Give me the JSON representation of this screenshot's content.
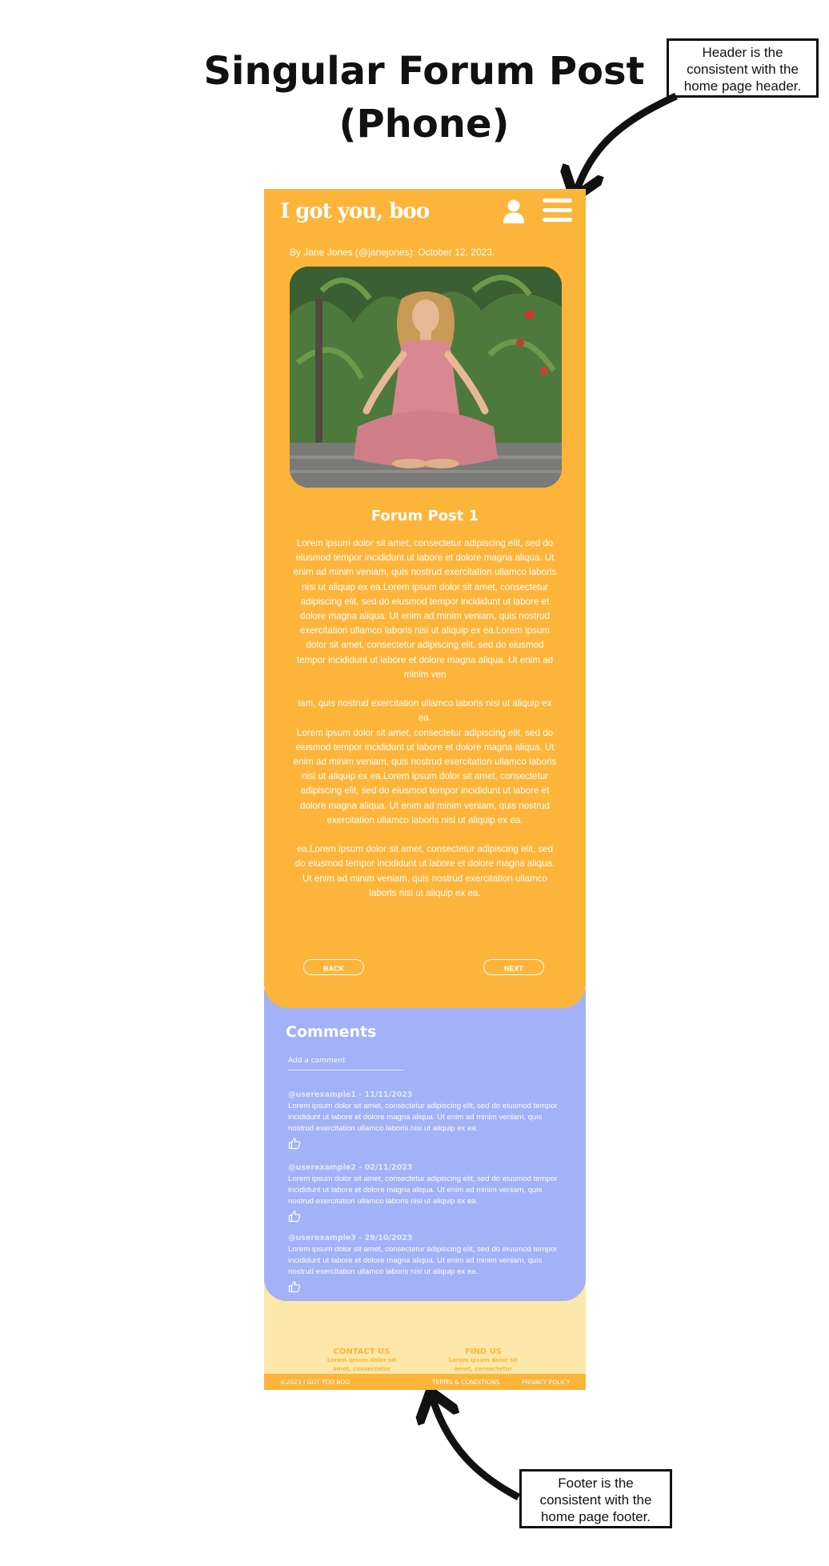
{
  "page": {
    "title_line1": "Singular Forum Post",
    "title_line2": "(Phone)"
  },
  "annotations": {
    "header_note": "Header is the consistent with the home page header.",
    "footer_note": "Footer is the consistent with the home page footer."
  },
  "header": {
    "logo": "I got you, boo",
    "icons": [
      "user-icon",
      "menu-icon"
    ]
  },
  "post": {
    "byline": "By Jane Jones (@janejones): October 12, 2023.",
    "image_alt": "Woman meditating cross-legged in a garden",
    "title": "Forum Post 1",
    "paragraphs": [
      "Lorem ipsum dolor sit amet, consectetur adipiscing elit, sed do eiusmod tempor incididunt ut labore et dolore magna aliqua. Ut enim ad minim veniam, quis nostrud exercitation ullamco laboris nisi ut aliquip ex ea.Lorem ipsum dolor sit amet, consectetur adipiscing elit, sed do eiusmod tempor incididunt ut labore et dolore magna aliqua. Ut enim ad minim veniam, quis nostrud exercitation ullamco laboris nisi ut aliquip ex ea.Lorem ipsum dolor sit amet, consectetur adipiscing elit, sed do eiusmod tempor incididunt ut labore et dolore magna aliqua. Ut enim ad minim ven",
      "iam, quis nostrud exercitation ullamco laboris nisi ut aliquip ex ea.\nLorem ipsum dolor sit amet, consectetur adipiscing elit, sed do eiusmod tempor incididunt ut labore et dolore magna aliqua. Ut enim ad minim veniam, quis nostrud exercitation ullamco laboris nisi ut aliquip ex ea.Lorem ipsum dolor sit amet, consectetur adipiscing elit, sed do eiusmod tempor incididunt ut labore et dolore magna aliqua. Ut enim ad minim veniam, quis nostrud exercitation ullamco laboris nisi ut aliquip ex ea.",
      "ea.Lorem ipsum dolor sit amet, consectetur adipiscing elit, sed do eiusmod tempor incididunt ut labore et dolore magna aliqua. Ut enim ad minim veniam, quis nostrud exercitation ullamco laboris nisi ut aliquip ex ea."
    ],
    "back_label": "BACK",
    "next_label": "NEXT"
  },
  "comments": {
    "title": "Comments",
    "add_placeholder": "Add a comment",
    "items": [
      {
        "meta": "@userexample1 - 11/11/2023",
        "text": "Lorem ipsum dolor sit amet, consectetur adipiscing elit, sed do eiusmod tempor incididunt ut labore et dolore magna aliqua. Ut enim ad minim veniam, quis nostrud exercitation ullamco laboris nisi ut aliquip ex ea."
      },
      {
        "meta": "@userexample2 - 02/11/2023",
        "text": "Lorem ipsum dolor sit amet, consectetur adipiscing elit, sed do eiusmod tempor incididunt ut labore et dolore magna aliqua. Ut enim ad minim veniam, quis nostrud exercitation ullamco laboris nisi ut aliquip ex ea."
      },
      {
        "meta": "@userexample3 - 29/10/2023",
        "text": "Lorem ipsum dolor sit amet, consectetur adipiscing elit, sed do eiusmod tempor incididunt ut labore et dolore magna aliqua. Ut enim ad minim veniam, quis nostrud exercitation ullamco laboris nisi ut aliquip ex ea."
      }
    ]
  },
  "footer": {
    "contact_title": "CONTACT US",
    "contact_text": "Lorem ipsum dolor sit amet, consectetur adipiscing elit, sed do",
    "find_title": "FIND US",
    "find_text": "Lorem ipsum dolor sit amet, consectetur adipiscing elit, sed do",
    "copyright": "©2023 I GOT YOU BOO",
    "terms": "TERMS & CONDITIONS",
    "privacy": "PRIVACY POLICY"
  },
  "colors": {
    "primary": "#fcb53a",
    "comments_bg": "#a3b1f8",
    "footer_bg": "#fde8a9"
  }
}
